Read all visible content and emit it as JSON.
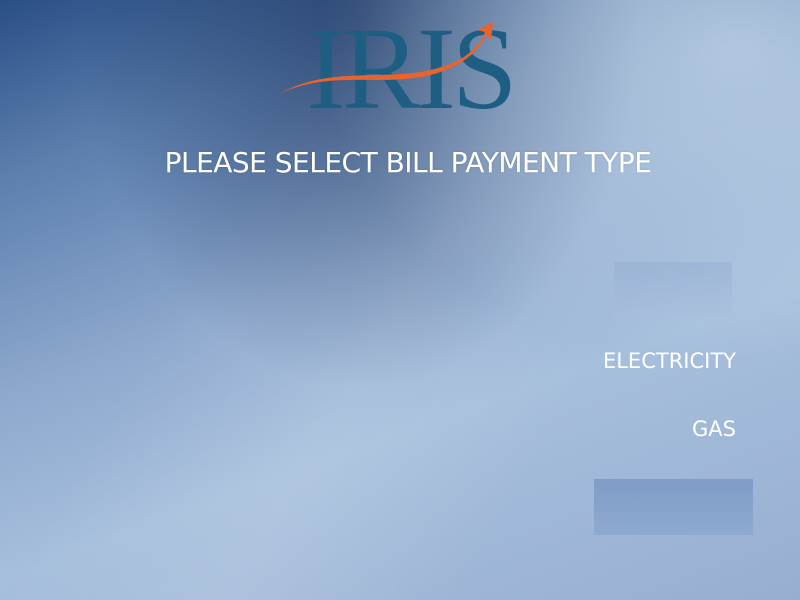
{
  "logo": {
    "text": "IRIS",
    "text_color": "#1e5e82",
    "swoosh_color": "#e8642c"
  },
  "screen": {
    "title": "PLEASE SELECT BILL PAYMENT TYPE"
  },
  "options": {
    "electricity": "ELECTRICITY",
    "gas": "GAS"
  }
}
